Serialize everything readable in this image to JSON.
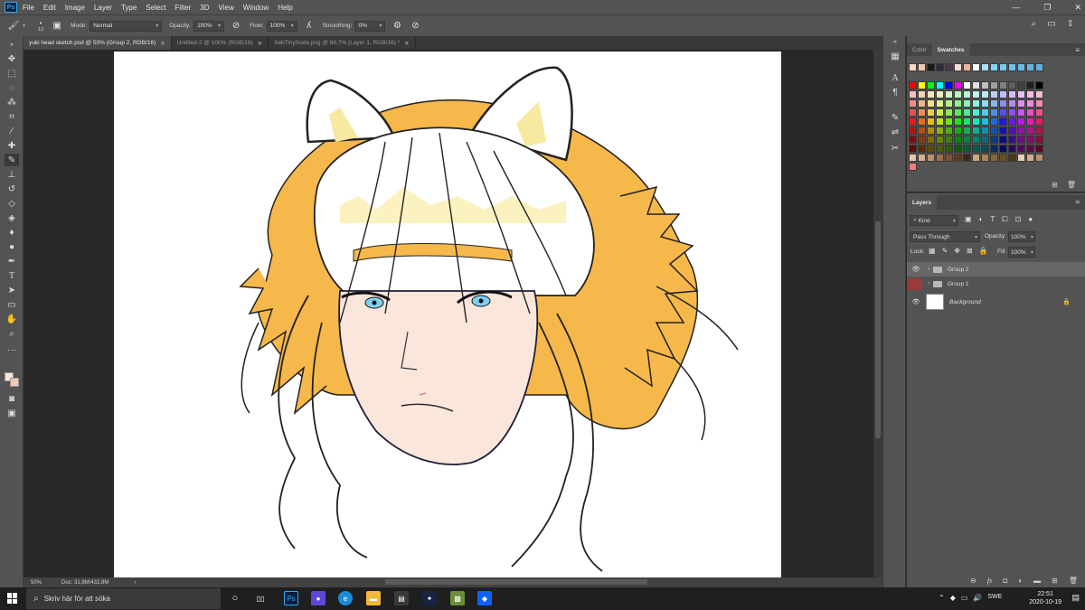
{
  "app": {
    "logo": "Ps",
    "colors": {
      "accent": "#31a8ff",
      "ui_bg": "#535353",
      "dark": "#282828"
    }
  },
  "menu": [
    "File",
    "Edit",
    "Image",
    "Layer",
    "Type",
    "Select",
    "Filter",
    "3D",
    "View",
    "Window",
    "Help"
  ],
  "options": {
    "brush_size": "12",
    "mode_label": "Mode:",
    "mode_value": "Normal",
    "opacity_label": "Opacity:",
    "opacity_value": "100%",
    "flow_label": "Flow:",
    "flow_value": "100%",
    "smoothing_label": "Smoothing:",
    "smoothing_value": "0%"
  },
  "tabs": [
    {
      "label": "yuki head sketch.psd @ 50% (Group 2, RGB/16)",
      "active": true
    },
    {
      "label": "Untitled-2 @ 100% (RGB/16)",
      "active": false
    },
    {
      "label": "SebTinySoda.png @ 66,7% (Layer 1, RGB/16) *",
      "active": false
    }
  ],
  "status": {
    "zoom": "50%",
    "doc": "Doc: 31,9M/432,8M"
  },
  "swatches_panel": {
    "tab_color": "Color",
    "tab_swatches": "Swatches"
  },
  "layers_panel": {
    "tab": "Layers",
    "kind_label": "Kind",
    "blend_mode": "Pass Through",
    "opacity_label": "Opacity:",
    "opacity_value": "100%",
    "lock_label": "Lock:",
    "fill_label": "Fill:",
    "fill_value": "100%",
    "layers": [
      {
        "name": "Group 2",
        "type": "group",
        "visible": true,
        "selected": true
      },
      {
        "name": "Group 1",
        "type": "group",
        "visible": false,
        "selected": false
      },
      {
        "name": "Background",
        "type": "pixel",
        "visible": true,
        "selected": false,
        "locked": true
      }
    ]
  },
  "taskbar": {
    "search_placeholder": "Skriv här för att söka",
    "language": "SWE",
    "time": "22:51",
    "date": "2020-10-19"
  }
}
